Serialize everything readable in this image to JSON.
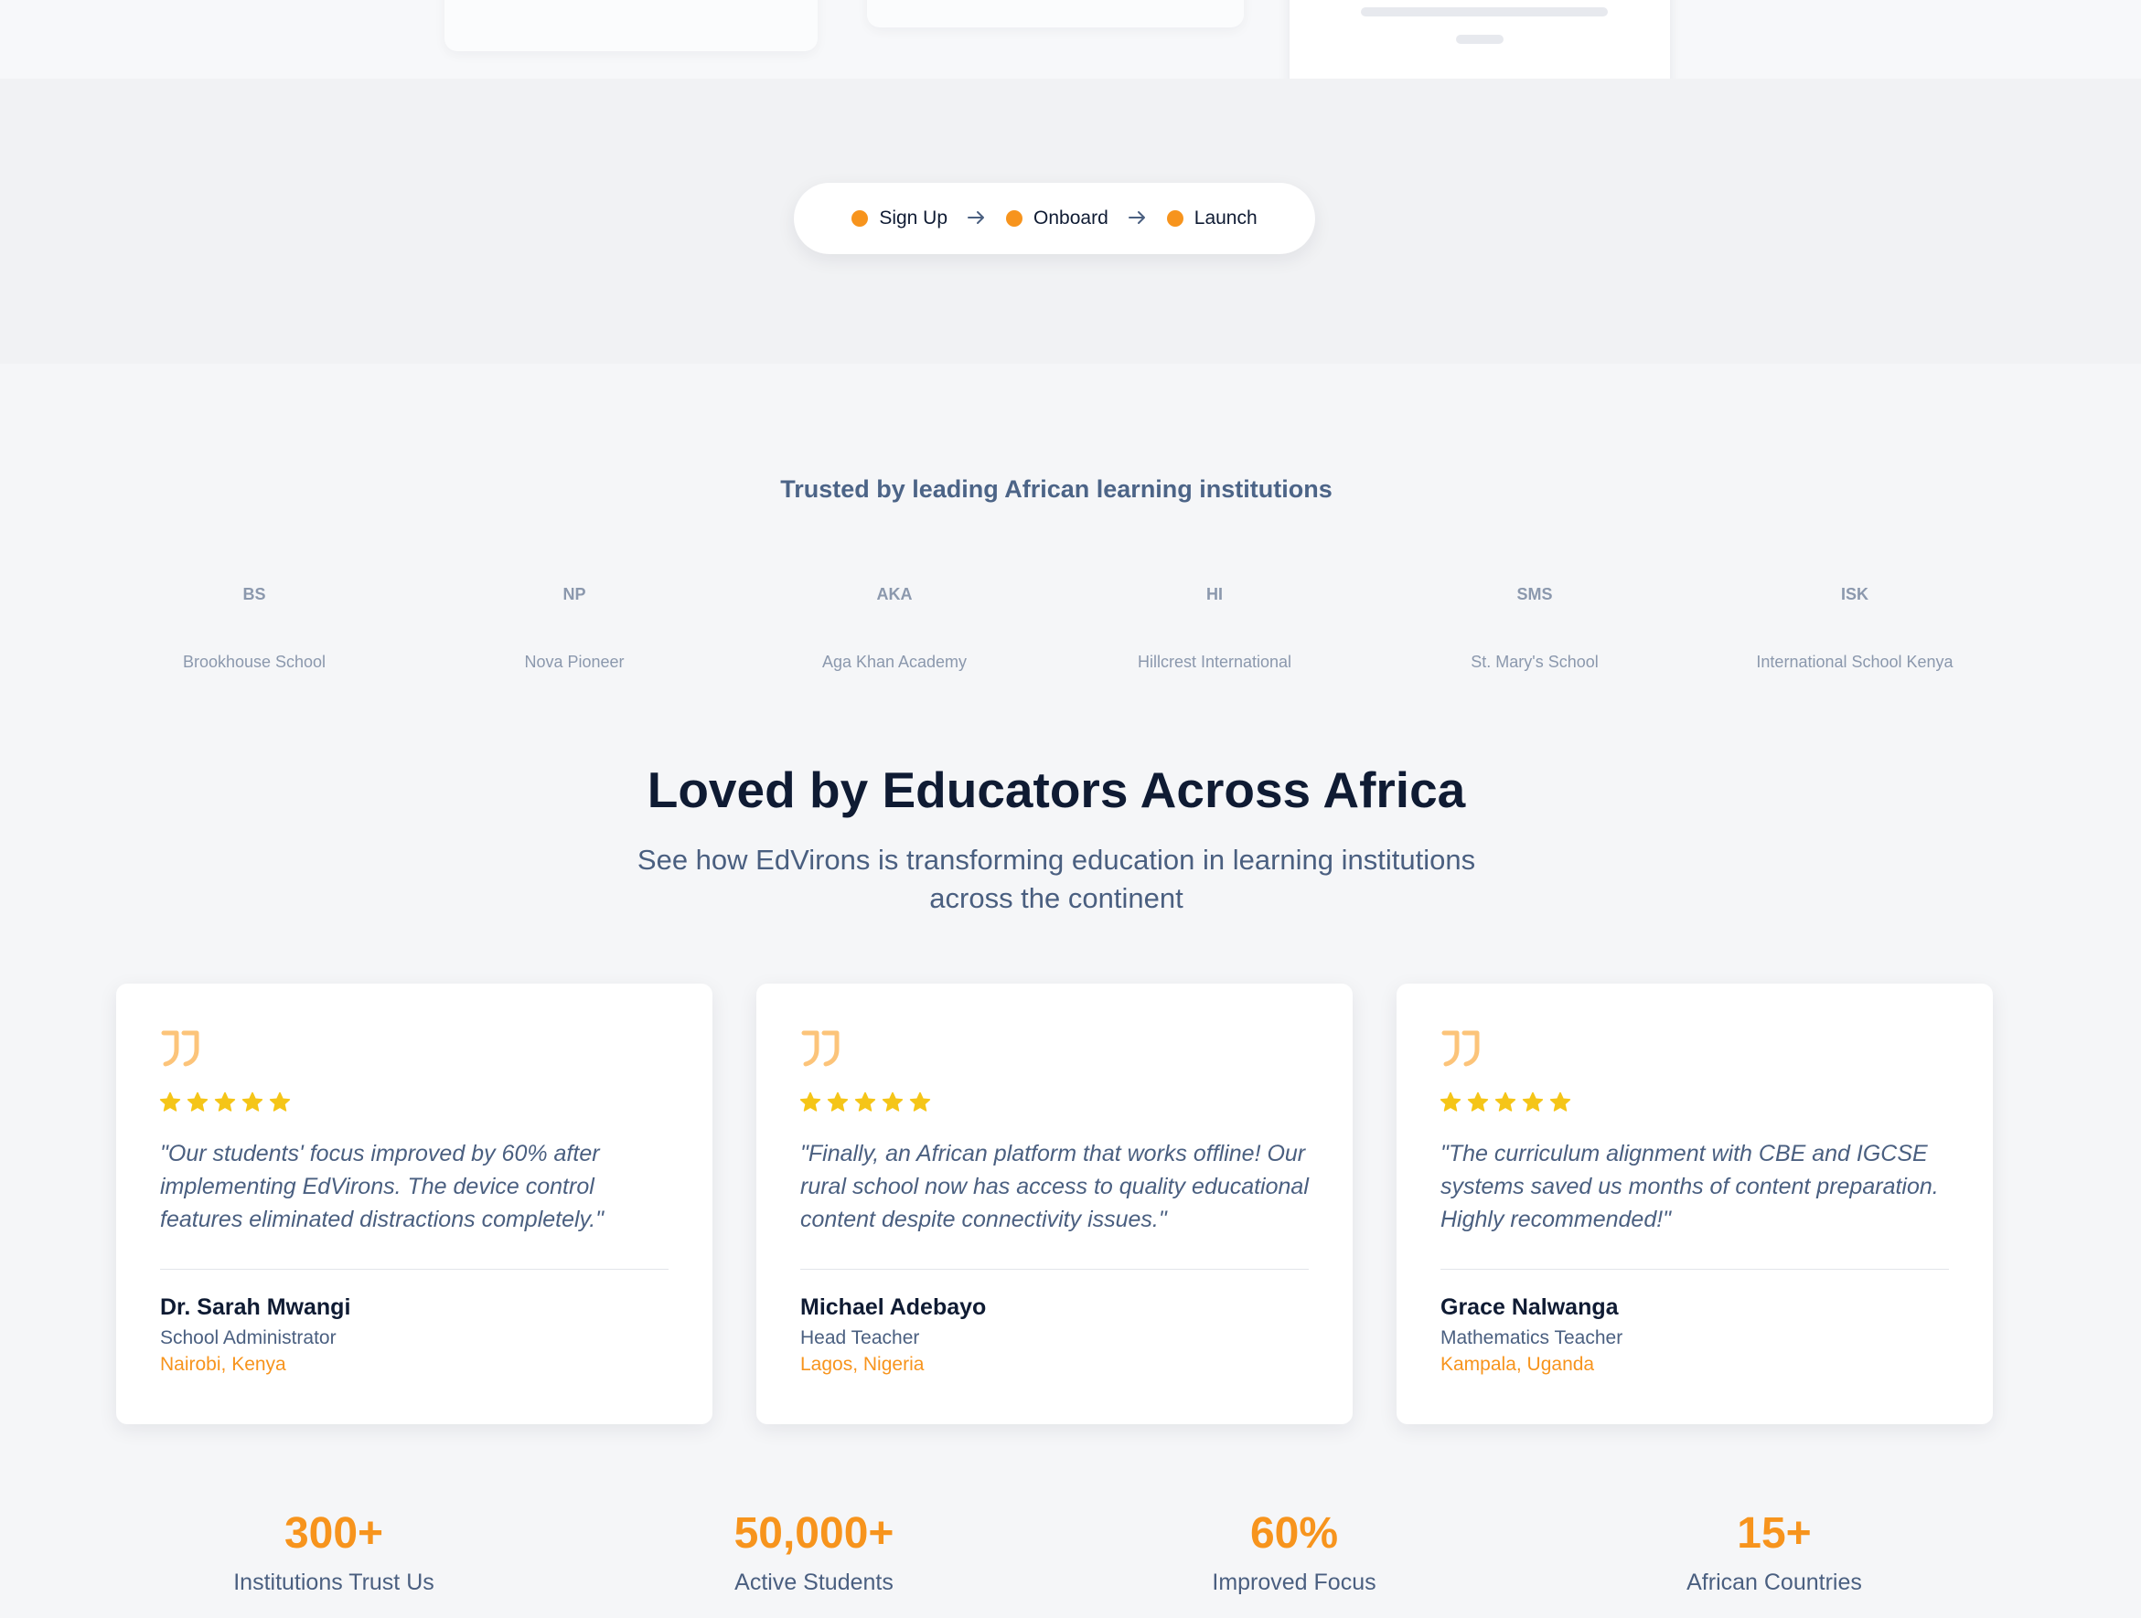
{
  "steps": [
    {
      "label": "Sign Up"
    },
    {
      "label": "Onboard"
    },
    {
      "label": "Launch"
    }
  ],
  "trusted": {
    "title": "Trusted by leading African learning institutions",
    "institutions": [
      {
        "abbr": "BS",
        "name": "Brookhouse School"
      },
      {
        "abbr": "NP",
        "name": "Nova Pioneer"
      },
      {
        "abbr": "AKA",
        "name": "Aga Khan Academy"
      },
      {
        "abbr": "HI",
        "name": "Hillcrest International"
      },
      {
        "abbr": "SMS",
        "name": "St. Mary's School"
      },
      {
        "abbr": "ISK",
        "name": "International School Kenya"
      }
    ]
  },
  "testimonials": {
    "title": "Loved by Educators Across Africa",
    "subtitle": "See how EdVirons is transforming education in learning institutions across the continent",
    "items": [
      {
        "quote": "\"Our students' focus improved by 60% after implementing EdVirons. The device control features eliminated distractions completely.\"",
        "name": "Dr. Sarah Mwangi",
        "role": "School Administrator",
        "location": "Nairobi, Kenya",
        "rating": 5
      },
      {
        "quote": "\"Finally, an African platform that works offline! Our rural school now has access to quality educational content despite connectivity issues.\"",
        "name": "Michael Adebayo",
        "role": "Head Teacher",
        "location": "Lagos, Nigeria",
        "rating": 5
      },
      {
        "quote": "\"The curriculum alignment with CBE and IGCSE systems saved us months of content preparation. Highly recommended!\"",
        "name": "Grace Nalwanga",
        "role": "Mathematics Teacher",
        "location": "Kampala, Uganda",
        "rating": 5
      }
    ]
  },
  "stats": [
    {
      "value": "300+",
      "label": "Institutions Trust Us"
    },
    {
      "value": "50,000+",
      "label": "Active Students"
    },
    {
      "value": "60%",
      "label": "Improved Focus"
    },
    {
      "value": "15+",
      "label": "African Countries"
    }
  ],
  "colors": {
    "accent": "#f7941d",
    "star": "#f5c518",
    "heading": "#0f1b33",
    "muted": "#4a5f80"
  },
  "icons": {
    "quote": "quote-icon",
    "star": "star-icon",
    "arrow": "arrow-right-icon"
  }
}
